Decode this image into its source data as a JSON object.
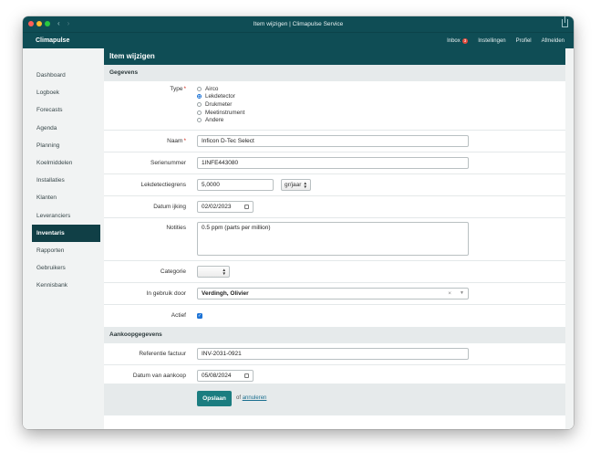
{
  "window": {
    "title": "Item wijzigen | Climapulse Service"
  },
  "app": {
    "logo": "Climapulse"
  },
  "topnav": {
    "inbox": {
      "label": "Inbox",
      "count": "3"
    },
    "settings": "Instellingen",
    "profile": "Profiel",
    "logout": "Afmelden"
  },
  "sidebar": {
    "items": [
      {
        "label": "Dashboard",
        "active": false
      },
      {
        "label": "Logboek",
        "active": false
      },
      {
        "label": "Forecasts",
        "active": false
      },
      {
        "label": "Agenda",
        "active": false
      },
      {
        "label": "Planning",
        "active": false
      },
      {
        "label": "Koelmiddelen",
        "active": false
      },
      {
        "label": "Installaties",
        "active": false
      },
      {
        "label": "Klanten",
        "active": false
      },
      {
        "label": "Leveranciers",
        "active": false
      },
      {
        "label": "Inventaris",
        "active": true
      },
      {
        "label": "Rapporten",
        "active": false
      },
      {
        "label": "Gebruikers",
        "active": false
      },
      {
        "label": "Kennisbank",
        "active": false
      }
    ]
  },
  "page": {
    "title": "Item wijzigen"
  },
  "sections": {
    "details": "Gegevens",
    "purchase": "Aankoopgegevens"
  },
  "form": {
    "type": {
      "label": "Type",
      "required_mark": "*",
      "options": [
        "Airco",
        "Lekdetector",
        "Drukmeter",
        "Meetinstrument",
        "Andere"
      ],
      "selected": "Lekdetector"
    },
    "name": {
      "label": "Naam",
      "required_mark": "*",
      "value": "Inficon D-Tec Select"
    },
    "serial": {
      "label": "Serienummer",
      "value": "1INFE443080"
    },
    "threshold": {
      "label": "Lekdetectiegrens",
      "value": "5,0000",
      "unit": "gr/jaar"
    },
    "calibration_date": {
      "label": "Datum ijking",
      "value": "02/02/2023"
    },
    "notes": {
      "label": "Notities",
      "value": "0.5 ppm (parts per million)"
    },
    "category": {
      "label": "Categorie",
      "value": ""
    },
    "in_use_by": {
      "label": "In gebruik door",
      "value": "Verdingh, Olivier"
    },
    "active": {
      "label": "Actief",
      "checked": true
    },
    "invoice_ref": {
      "label": "Referentie factuur",
      "value": "INV-2031-0921"
    },
    "purchase_date": {
      "label": "Datum van aankoop",
      "value": "05/08/2024"
    }
  },
  "actions": {
    "save": "Opslaan",
    "cancel_prefix": "of",
    "cancel": "annuleren"
  },
  "colors": {
    "brand": "#0f4d55",
    "accent": "#1b7d80",
    "badge": "#e04a3c",
    "required": "#d0281c"
  }
}
